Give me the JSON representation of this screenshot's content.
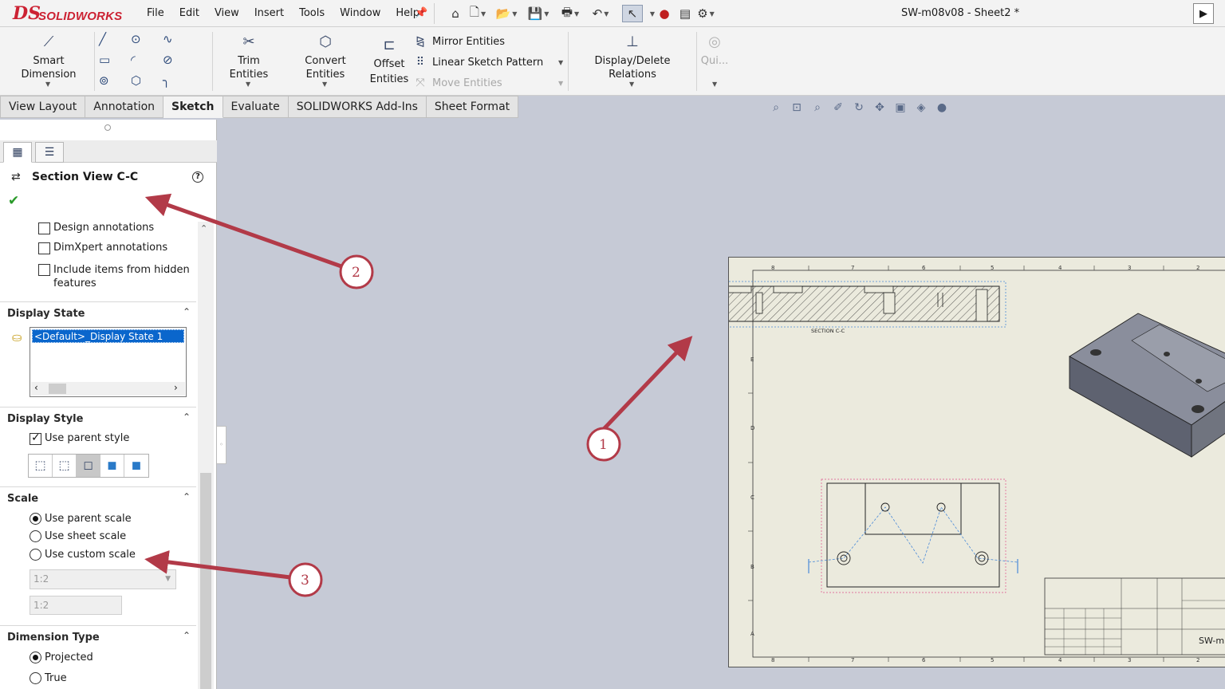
{
  "app": {
    "logo_ds": "DS",
    "logo_text": "SOLIDWORKS",
    "window_title": "SW-m08v08 - Sheet2 *"
  },
  "menu": [
    "File",
    "Edit",
    "View",
    "Insert",
    "Tools",
    "Window",
    "Help"
  ],
  "ribbon": {
    "smart_dimension": "Smart Dimension",
    "trim_entities": "Trim Entities",
    "convert_entities": "Convert Entities",
    "offset_entities_1": "Offset",
    "offset_entities_2": "Entities",
    "mirror_entities": "Mirror Entities",
    "linear_sketch_pattern": "Linear Sketch Pattern",
    "move_entities": "Move Entities",
    "display_delete_relations": "Display/Delete Relations",
    "quick_snaps": "Qui..."
  },
  "tabs": [
    "View Layout",
    "Annotation",
    "Sketch",
    "Evaluate",
    "SOLIDWORKS Add-Ins",
    "Sheet Format"
  ],
  "active_tab": "Sketch",
  "property_manager": {
    "title": "Section View C-C",
    "help": "?",
    "import_options": [
      {
        "label": "Design annotations",
        "checked": false
      },
      {
        "label": "DimXpert annotations",
        "checked": false
      },
      {
        "label_1": "Include items from hidden",
        "label_2": "features",
        "checked": false
      }
    ],
    "display_state": {
      "header": "Display State",
      "selected": "<Default>_Display State 1"
    },
    "display_style": {
      "header": "Display Style",
      "use_parent_style": "Use parent style",
      "use_parent_checked": true,
      "active_style_index": 2
    },
    "scale": {
      "header": "Scale",
      "options": [
        "Use parent scale",
        "Use sheet scale",
        "Use custom scale"
      ],
      "selected_index": 0,
      "custom_dropdown": "1:2",
      "custom_text": "1:2"
    },
    "dimension_type": {
      "header": "Dimension Type",
      "options": [
        "Projected",
        "True"
      ],
      "selected_index": 0
    }
  },
  "drawing": {
    "section_label": "SECTION C-C",
    "title_block_text": "SW-m",
    "zone_top": [
      "8",
      "7",
      "6",
      "5",
      "4",
      "3",
      "2"
    ],
    "zone_side": [
      "E",
      "D",
      "C",
      "B",
      "A"
    ]
  },
  "callouts": [
    "1",
    "2",
    "3"
  ],
  "colors": {
    "callout": "#b23a48",
    "selection": "#0a66cc",
    "sheet": "#ebeadd",
    "graphics_bg": "#c6cad6"
  }
}
